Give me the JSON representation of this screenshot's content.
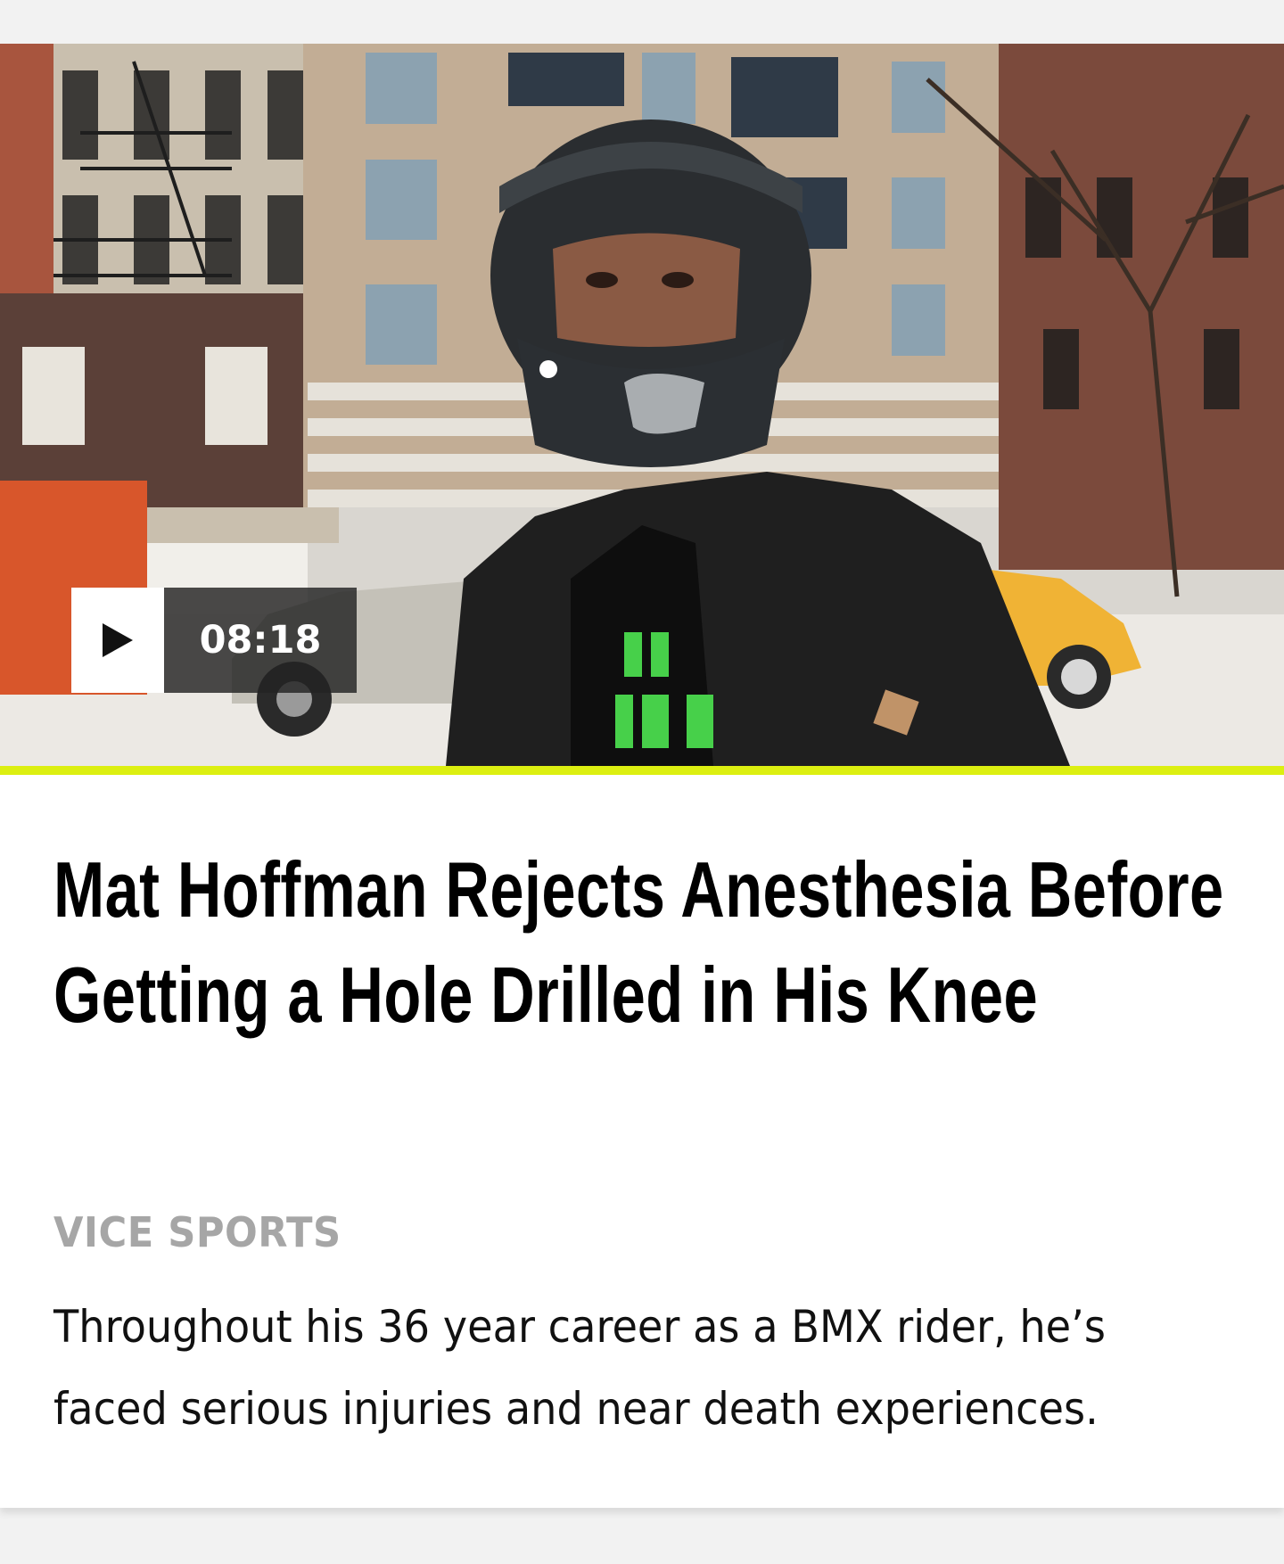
{
  "video": {
    "duration": "08:18",
    "thumbnail_alt": "Mat Hoffman in a motocross helmet on a city street",
    "play_icon": "play-icon"
  },
  "article": {
    "title": "Mat Hoffman Rejects Anesthesia Before Getting a Hole Drilled in His Knee",
    "channel": "VICE SPORTS",
    "dek": "Throughout his 36 year career as a BMX rider, he’s faced serious injuries and near death experiences."
  },
  "colors": {
    "accent": "#dcef11",
    "channel_text": "#a6a6a6"
  }
}
